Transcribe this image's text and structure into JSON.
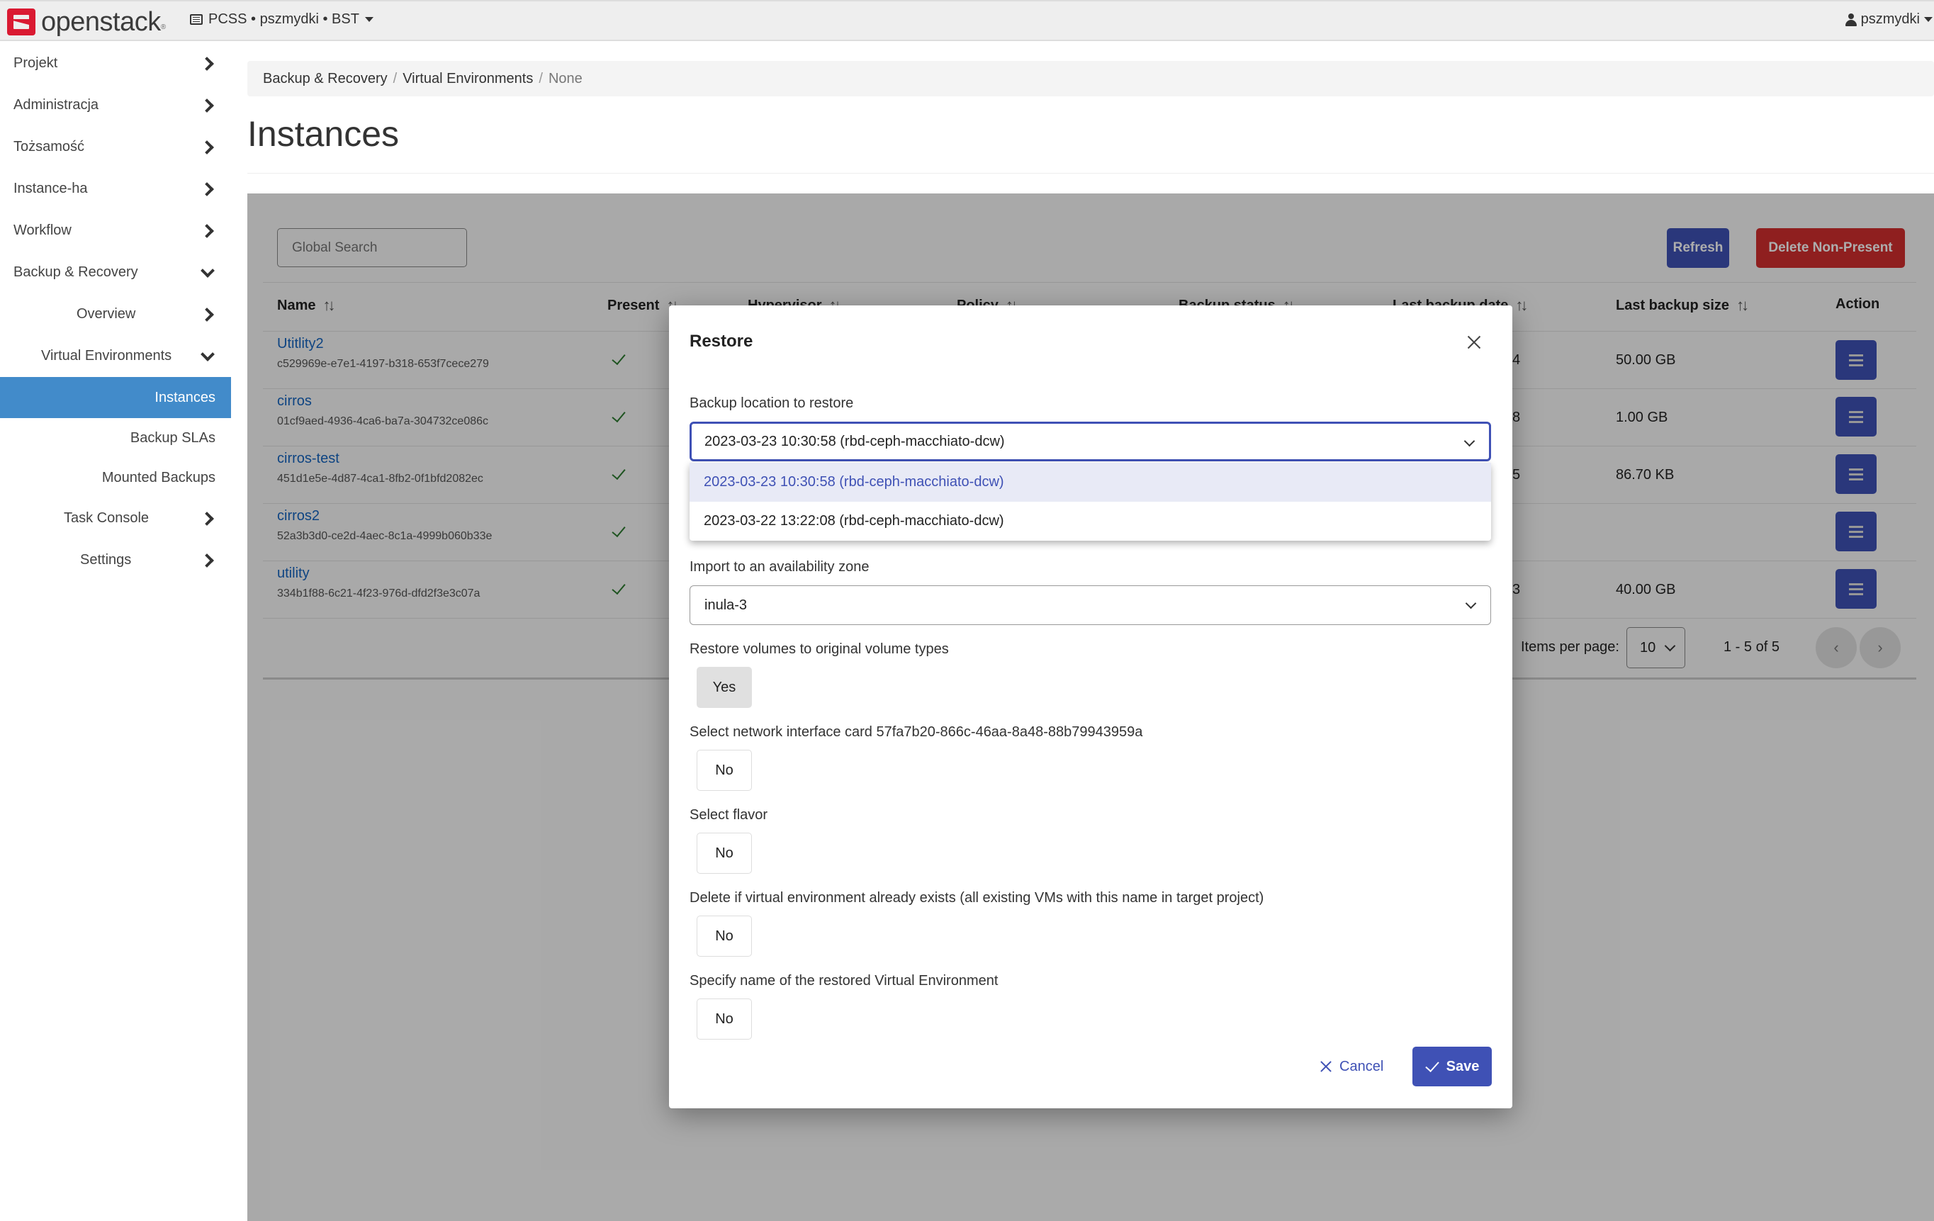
{
  "navbar": {
    "brand": "openstack",
    "project_picker": "PCSS • pszmydki • BST",
    "user": "pszmydki"
  },
  "sidebar": {
    "items": [
      {
        "label": "Projekt",
        "chevron": "right"
      },
      {
        "label": "Administracja",
        "chevron": "right"
      },
      {
        "label": "Tożsamość",
        "chevron": "right"
      },
      {
        "label": "Instance-ha",
        "chevron": "right"
      },
      {
        "label": "Workflow",
        "chevron": "right"
      },
      {
        "label": "Backup & Recovery",
        "chevron": "down"
      },
      {
        "label": "Overview",
        "chevron": "right"
      },
      {
        "label": "Virtual Environments",
        "chevron": "down"
      },
      {
        "label": "Instances",
        "active": true
      },
      {
        "label": "Backup SLAs"
      },
      {
        "label": "Mounted Backups"
      },
      {
        "label": "Task Console",
        "chevron": "right"
      },
      {
        "label": "Settings",
        "chevron": "right"
      }
    ]
  },
  "breadcrumb": [
    "Backup & Recovery",
    "Virtual Environments",
    "None"
  ],
  "page_title": "Instances",
  "toolbar": {
    "search_placeholder": "Global Search",
    "refresh_label": "Refresh",
    "delete_label": "Delete Non-Present"
  },
  "table": {
    "columns": [
      "Name",
      "Present",
      "Hypervisor",
      "Policy",
      "Backup status",
      "Last backup date",
      "Last backup size",
      "Action"
    ],
    "sort_glyph": "↑↓",
    "rows": [
      {
        "name": "Utitlity2",
        "id": "c529969e-e7e1-4197-b318-653f7cece279",
        "present": true,
        "last_backup_date_tail": "4",
        "last_backup_size": "50.00 GB"
      },
      {
        "name": "cirros",
        "id": "01cf9aed-4936-4ca6-ba7a-304732ce086c",
        "present": true,
        "last_backup_date_tail": "8",
        "last_backup_size": "1.00 GB"
      },
      {
        "name": "cirros-test",
        "id": "451d1e5e-4d87-4ca1-8fb2-0f1bfd2082ec",
        "present": true,
        "last_backup_date_tail": "5",
        "last_backup_size": "86.70 KB"
      },
      {
        "name": "cirros2",
        "id": "52a3b3d0-ce2d-4aec-8c1a-4999b060b33e",
        "present": true,
        "last_backup_date_tail": "",
        "last_backup_size": ""
      },
      {
        "name": "utility",
        "id": "334b1f88-6c21-4f23-976d-dfd2f3e3c07a",
        "present": true,
        "last_backup_date_tail": "3",
        "last_backup_size": "40.00 GB"
      }
    ]
  },
  "pagination": {
    "items_per_page_label": "Items per page:",
    "items_per_page": "10",
    "range": "1 - 5 of 5",
    "prev": "‹",
    "next": "›"
  },
  "modal": {
    "title": "Restore",
    "backup_location": {
      "label": "Backup location to restore",
      "value": "2023-03-23 10:30:58 (rbd-ceph-macchiato-dcw)",
      "options": [
        "2023-03-23 10:30:58 (rbd-ceph-macchiato-dcw)",
        "2023-03-22 13:22:08 (rbd-ceph-macchiato-dcw)"
      ]
    },
    "availability_zone": {
      "label": "Import to an availability zone",
      "value": "inula-3"
    },
    "toggles": [
      {
        "label": "Restore volumes to original volume types",
        "value": "Yes"
      },
      {
        "label": "Select network interface card 57fa7b20-866c-46aa-8a48-88b79943959a",
        "value": "No"
      },
      {
        "label": "Select flavor",
        "value": "No"
      },
      {
        "label": "Delete if virtual environment already exists (all existing VMs with this name in target project)",
        "value": "No"
      },
      {
        "label": "Specify name of the restored Virtual Environment",
        "value": "No"
      }
    ],
    "cancel_label": "Cancel",
    "save_label": "Save"
  },
  "colors": {
    "primary": "#3f51b5",
    "danger": "#d32f2f",
    "sidebar_active": "#428bca",
    "link": "#1565c0",
    "success": "#2e7d32",
    "brand_red": "#da1a32"
  }
}
